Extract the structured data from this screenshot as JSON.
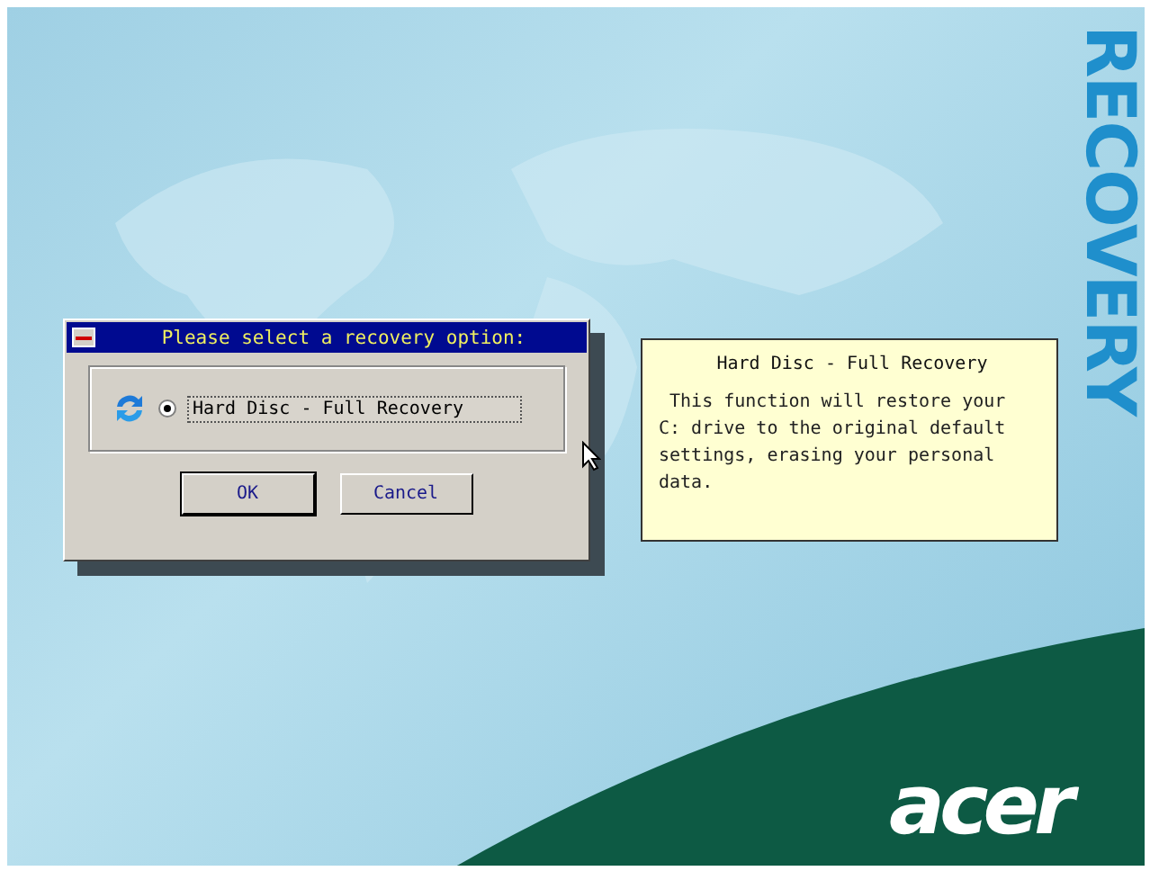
{
  "dialog": {
    "title": "Please select a recovery option:",
    "options": [
      {
        "label": "Hard Disc - Full Recovery",
        "selected": true
      }
    ],
    "buttons": [
      "OK",
      "Cancel"
    ]
  },
  "info_panel": {
    "title": "Hard Disc - Full Recovery",
    "body": "This function will restore your C: drive to the original default settings, erasing your personal data."
  },
  "watermark_word": "RECOVERY",
  "logo": "acer"
}
